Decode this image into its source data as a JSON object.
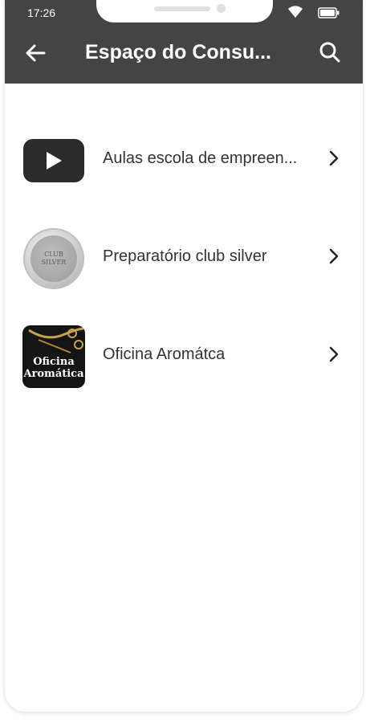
{
  "status_bar": {
    "time": "17:26"
  },
  "header": {
    "title": "Espaço do Consu..."
  },
  "items": [
    {
      "label": "Aulas escola de empreen...",
      "icon": "youtube-play-icon"
    },
    {
      "label": "Preparatório club silver",
      "icon": "club-silver-badge",
      "badge_text": [
        "CLUB",
        "SILVER"
      ]
    },
    {
      "label": "Oficina Aromátca",
      "icon": "oficina-aromatica-logo",
      "logo_text": [
        "Oficina",
        "Aromática"
      ]
    }
  ],
  "colors": {
    "header_bg": "#444444",
    "text": "#333333",
    "background": "#ffffff"
  }
}
